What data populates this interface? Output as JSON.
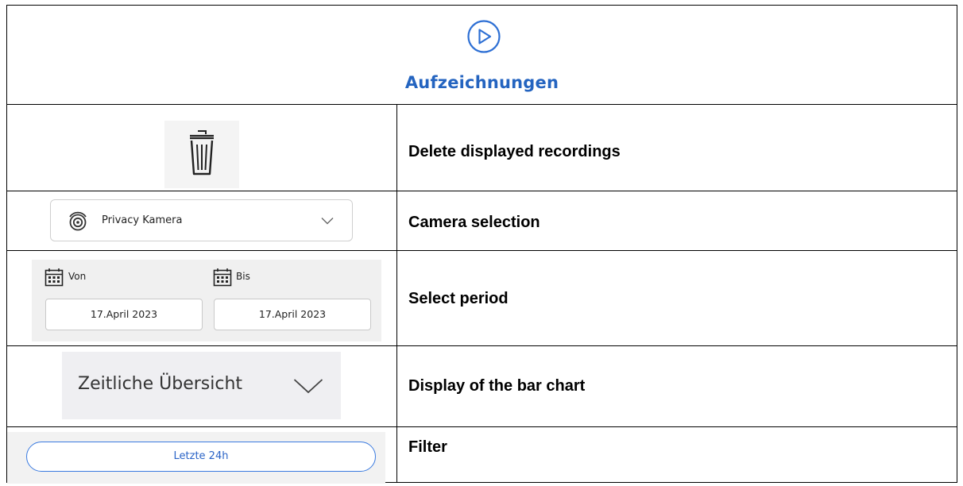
{
  "header": {
    "title": "Aufzeichnungen",
    "icon": "play-circle-icon",
    "accent": "#2464c0"
  },
  "rows": {
    "delete": {
      "icon": "trash-icon",
      "description": "Delete displayed recordings"
    },
    "camera": {
      "icon": "camera-icon",
      "label": "Privacy Kamera",
      "description": "Camera selection"
    },
    "period": {
      "from_label": "Von",
      "to_label": "Bis",
      "from_value": "17.April 2023",
      "to_value": "17.April 2023",
      "description": "Select period"
    },
    "overview": {
      "label": "Zeitliche Übersicht",
      "description": "Display of the bar chart"
    },
    "filter": {
      "label": "Letzte 24h",
      "description": "Filter",
      "accent": "#3b7be0"
    }
  }
}
